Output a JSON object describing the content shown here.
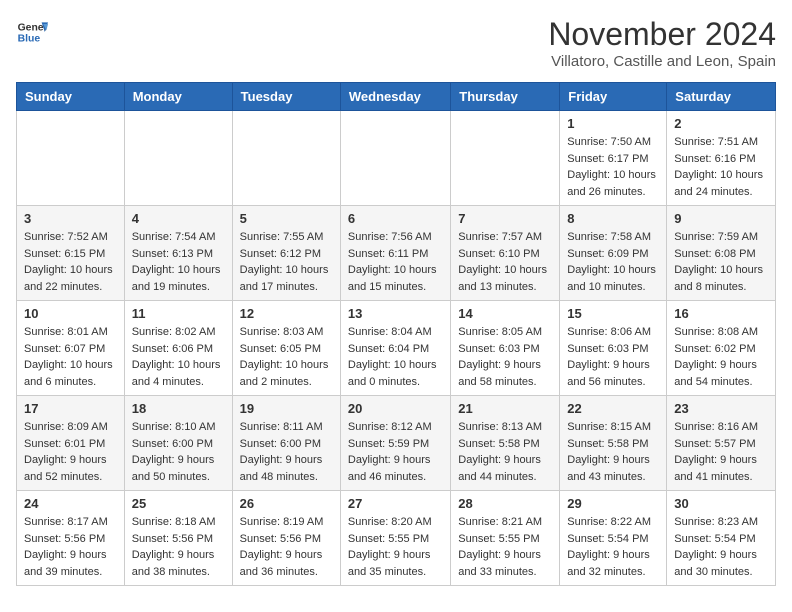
{
  "header": {
    "logo_line1": "General",
    "logo_line2": "Blue",
    "month": "November 2024",
    "location": "Villatoro, Castille and Leon, Spain"
  },
  "weekdays": [
    "Sunday",
    "Monday",
    "Tuesday",
    "Wednesday",
    "Thursday",
    "Friday",
    "Saturday"
  ],
  "weeks": [
    [
      {
        "day": "",
        "info": ""
      },
      {
        "day": "",
        "info": ""
      },
      {
        "day": "",
        "info": ""
      },
      {
        "day": "",
        "info": ""
      },
      {
        "day": "",
        "info": ""
      },
      {
        "day": "1",
        "info": "Sunrise: 7:50 AM\nSunset: 6:17 PM\nDaylight: 10 hours and 26 minutes."
      },
      {
        "day": "2",
        "info": "Sunrise: 7:51 AM\nSunset: 6:16 PM\nDaylight: 10 hours and 24 minutes."
      }
    ],
    [
      {
        "day": "3",
        "info": "Sunrise: 7:52 AM\nSunset: 6:15 PM\nDaylight: 10 hours and 22 minutes."
      },
      {
        "day": "4",
        "info": "Sunrise: 7:54 AM\nSunset: 6:13 PM\nDaylight: 10 hours and 19 minutes."
      },
      {
        "day": "5",
        "info": "Sunrise: 7:55 AM\nSunset: 6:12 PM\nDaylight: 10 hours and 17 minutes."
      },
      {
        "day": "6",
        "info": "Sunrise: 7:56 AM\nSunset: 6:11 PM\nDaylight: 10 hours and 15 minutes."
      },
      {
        "day": "7",
        "info": "Sunrise: 7:57 AM\nSunset: 6:10 PM\nDaylight: 10 hours and 13 minutes."
      },
      {
        "day": "8",
        "info": "Sunrise: 7:58 AM\nSunset: 6:09 PM\nDaylight: 10 hours and 10 minutes."
      },
      {
        "day": "9",
        "info": "Sunrise: 7:59 AM\nSunset: 6:08 PM\nDaylight: 10 hours and 8 minutes."
      }
    ],
    [
      {
        "day": "10",
        "info": "Sunrise: 8:01 AM\nSunset: 6:07 PM\nDaylight: 10 hours and 6 minutes."
      },
      {
        "day": "11",
        "info": "Sunrise: 8:02 AM\nSunset: 6:06 PM\nDaylight: 10 hours and 4 minutes."
      },
      {
        "day": "12",
        "info": "Sunrise: 8:03 AM\nSunset: 6:05 PM\nDaylight: 10 hours and 2 minutes."
      },
      {
        "day": "13",
        "info": "Sunrise: 8:04 AM\nSunset: 6:04 PM\nDaylight: 10 hours and 0 minutes."
      },
      {
        "day": "14",
        "info": "Sunrise: 8:05 AM\nSunset: 6:03 PM\nDaylight: 9 hours and 58 minutes."
      },
      {
        "day": "15",
        "info": "Sunrise: 8:06 AM\nSunset: 6:03 PM\nDaylight: 9 hours and 56 minutes."
      },
      {
        "day": "16",
        "info": "Sunrise: 8:08 AM\nSunset: 6:02 PM\nDaylight: 9 hours and 54 minutes."
      }
    ],
    [
      {
        "day": "17",
        "info": "Sunrise: 8:09 AM\nSunset: 6:01 PM\nDaylight: 9 hours and 52 minutes."
      },
      {
        "day": "18",
        "info": "Sunrise: 8:10 AM\nSunset: 6:00 PM\nDaylight: 9 hours and 50 minutes."
      },
      {
        "day": "19",
        "info": "Sunrise: 8:11 AM\nSunset: 6:00 PM\nDaylight: 9 hours and 48 minutes."
      },
      {
        "day": "20",
        "info": "Sunrise: 8:12 AM\nSunset: 5:59 PM\nDaylight: 9 hours and 46 minutes."
      },
      {
        "day": "21",
        "info": "Sunrise: 8:13 AM\nSunset: 5:58 PM\nDaylight: 9 hours and 44 minutes."
      },
      {
        "day": "22",
        "info": "Sunrise: 8:15 AM\nSunset: 5:58 PM\nDaylight: 9 hours and 43 minutes."
      },
      {
        "day": "23",
        "info": "Sunrise: 8:16 AM\nSunset: 5:57 PM\nDaylight: 9 hours and 41 minutes."
      }
    ],
    [
      {
        "day": "24",
        "info": "Sunrise: 8:17 AM\nSunset: 5:56 PM\nDaylight: 9 hours and 39 minutes."
      },
      {
        "day": "25",
        "info": "Sunrise: 8:18 AM\nSunset: 5:56 PM\nDaylight: 9 hours and 38 minutes."
      },
      {
        "day": "26",
        "info": "Sunrise: 8:19 AM\nSunset: 5:56 PM\nDaylight: 9 hours and 36 minutes."
      },
      {
        "day": "27",
        "info": "Sunrise: 8:20 AM\nSunset: 5:55 PM\nDaylight: 9 hours and 35 minutes."
      },
      {
        "day": "28",
        "info": "Sunrise: 8:21 AM\nSunset: 5:55 PM\nDaylight: 9 hours and 33 minutes."
      },
      {
        "day": "29",
        "info": "Sunrise: 8:22 AM\nSunset: 5:54 PM\nDaylight: 9 hours and 32 minutes."
      },
      {
        "day": "30",
        "info": "Sunrise: 8:23 AM\nSunset: 5:54 PM\nDaylight: 9 hours and 30 minutes."
      }
    ]
  ]
}
